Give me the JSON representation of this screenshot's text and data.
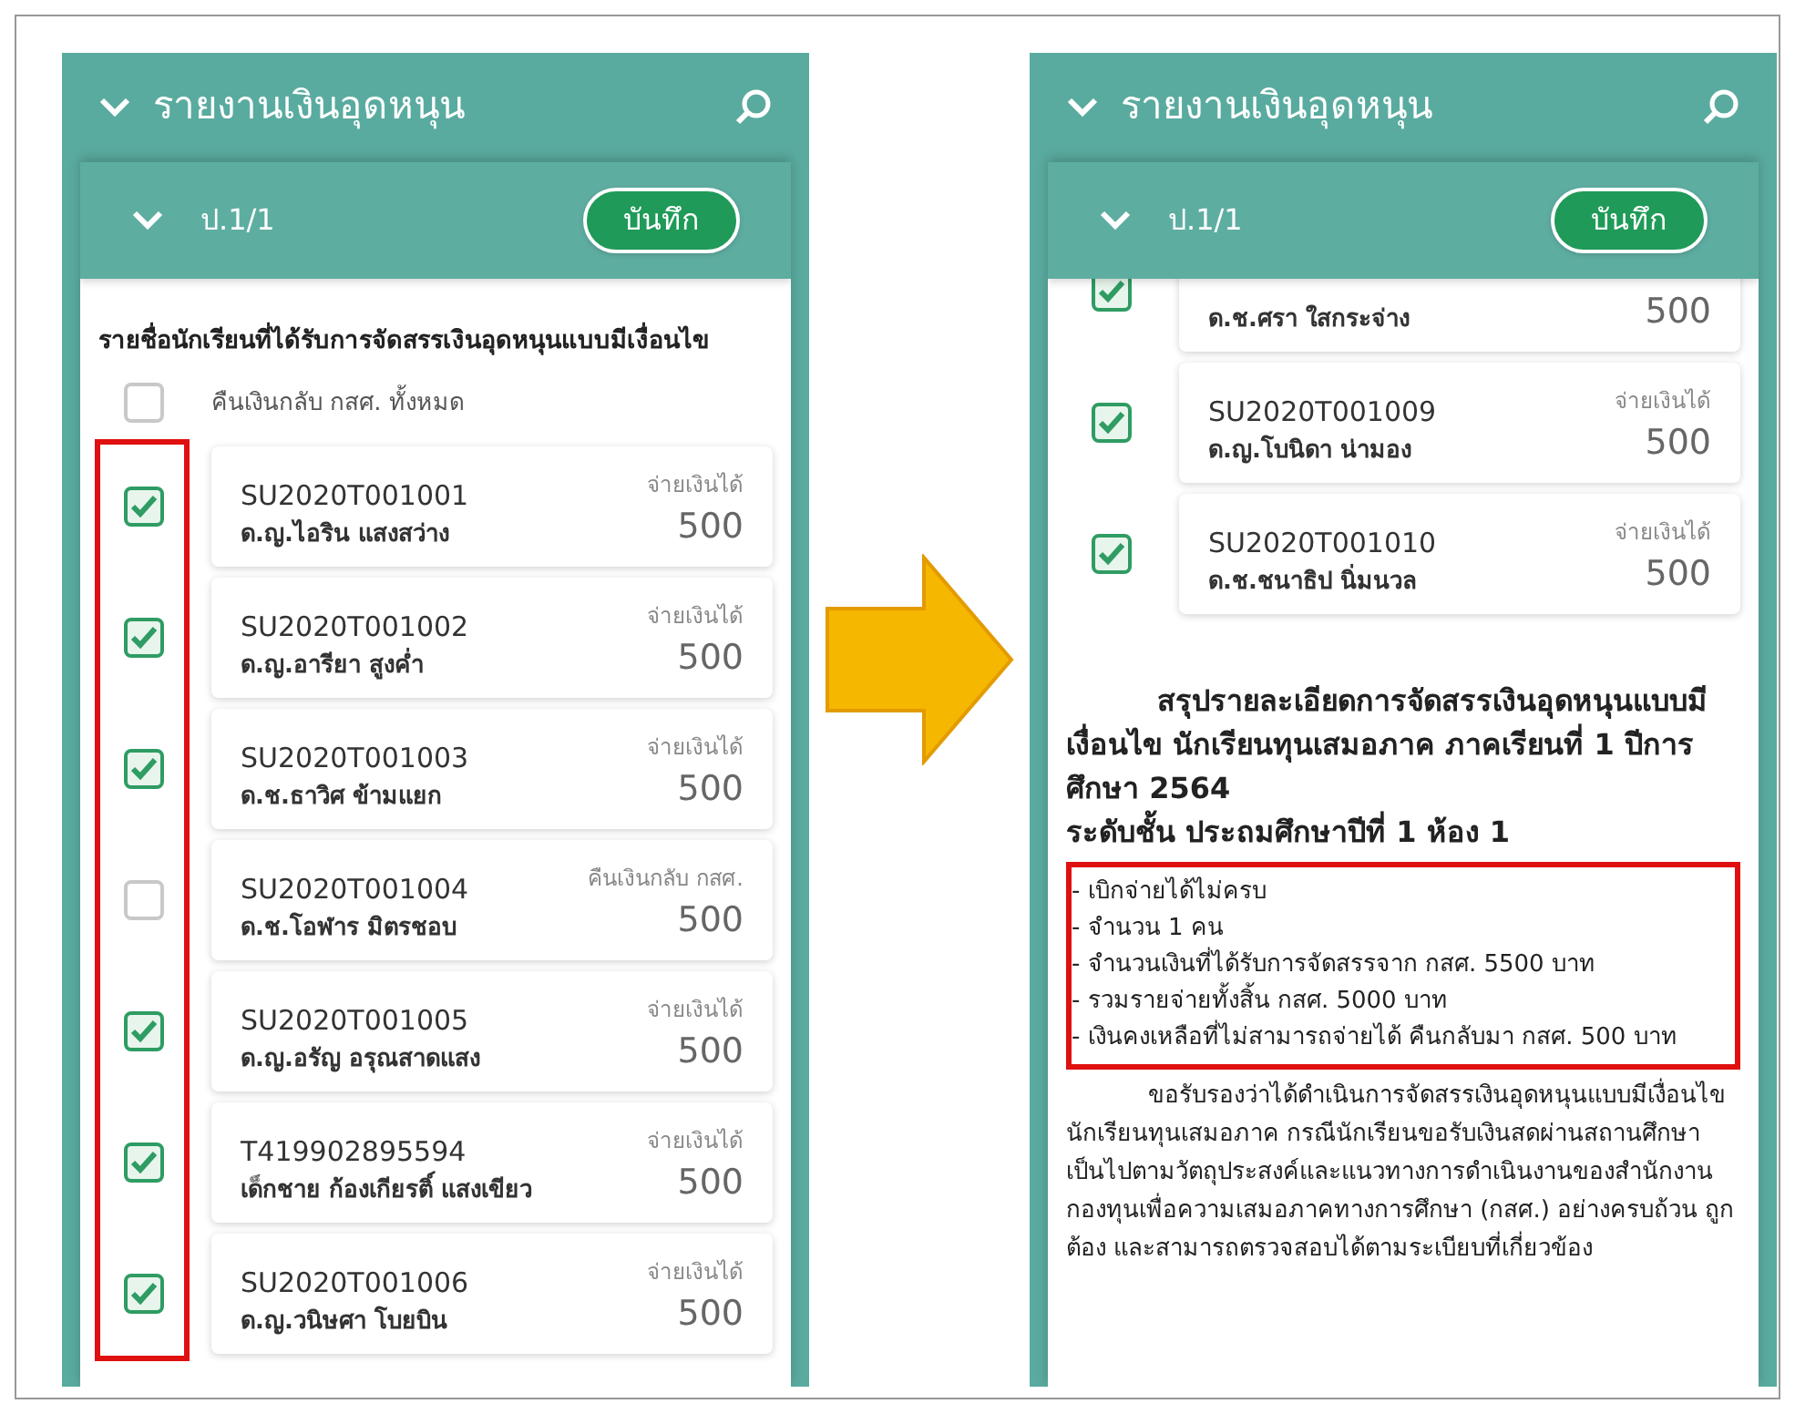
{
  "screens": [
    {
      "header_title": "รายงานเงินอุดหนุน",
      "class_label": "ป.1/1",
      "save_button": "บันทึก",
      "list_title": "รายชื่อนักเรียนที่ได้รับการจัดสรรเงินอุดหนุนแบบมีเงื่อนไข",
      "select_all": {
        "label": "คืนเงินกลับ กสศ. ทั้งหมด",
        "checked": false
      },
      "highlight_checkboxes": true,
      "students": [
        {
          "id": "SU2020T001001",
          "name": "ด.ญ.ไอริน แสงสว่าง",
          "status": "จ่ายเงินได้",
          "amount": "500",
          "checked": true
        },
        {
          "id": "SU2020T001002",
          "name": "ด.ญ.อารียา สูงค่ำ",
          "status": "จ่ายเงินได้",
          "amount": "500",
          "checked": true
        },
        {
          "id": "SU2020T001003",
          "name": "ด.ช.ธาวิศ ข้ามแยก",
          "status": "จ่ายเงินได้",
          "amount": "500",
          "checked": true
        },
        {
          "id": "SU2020T001004",
          "name": "ด.ช.โอฬาร มิตรชอบ",
          "status": "คืนเงินกลับ กสศ.",
          "amount": "500",
          "checked": false
        },
        {
          "id": "SU2020T001005",
          "name": "ด.ญ.อรัญ อรุณสาดแสง",
          "status": "จ่ายเงินได้",
          "amount": "500",
          "checked": true
        },
        {
          "id": "T419902895594",
          "name": "เด็กชาย ก้องเกียรติ์ แสงเขียว",
          "status": "จ่ายเงินได้",
          "amount": "500",
          "checked": true
        },
        {
          "id": "SU2020T001006",
          "name": "ด.ญ.วนิษศา โบยบิน",
          "status": "จ่ายเงินได้",
          "amount": "500",
          "checked": true
        }
      ]
    },
    {
      "header_title": "รายงานเงินอุดหนุน",
      "class_label": "ป.1/1",
      "save_button": "บันทึก",
      "highlight_checkboxes": false,
      "students": [
        {
          "name": "ด.ช.ศรา ใสกระจ่าง",
          "amount": "500",
          "checked": true
        },
        {
          "id": "SU2020T001009",
          "name": "ด.ญ.โบนิดา น่ามอง",
          "status": "จ่ายเงินได้",
          "amount": "500",
          "checked": true
        },
        {
          "id": "SU2020T001010",
          "name": "ด.ช.ชนาธิป นิ่มนวล",
          "status": "จ่ายเงินได้",
          "amount": "500",
          "checked": true
        }
      ],
      "summary": {
        "title": "สรุปรายละเอียดการจัดสรรเงินอุดหนุนแบบมีเงื่อนไข นักเรียนทุนเสมอภาค ภาคเรียนที่ 1 ปีการศึกษา 2564",
        "level": "ระดับชั้น ประถมศึกษาปีที่ 1 ห้อง 1",
        "highlighted": true,
        "items": [
          "- เบิกจ่ายได้ไม่ครบ",
          "- จำนวน 1 คน",
          "- จำนวนเงินที่ได้รับการจัดสรรจาก กสศ. 5500 บาท",
          "- รวมรายจ่ายทั้งสิ้น กสศ. 5000 บาท",
          "- เงินคงเหลือที่ไม่สามารถจ่ายได้ คืนกลับมา กสศ. 500 บาท"
        ],
        "certification": "ขอรับรองว่าได้ดำเนินการจัดสรรเงินอุดหนุนแบบมีเงื่อนไข นักเรียนทุนเสมอภาค กรณีนักเรียนขอรับเงินสดผ่านสถานศึกษา เป็นไปตามวัตถุประสงค์และแนวทางการดำเนินงานของสำนักงานกองทุนเพื่อความเสมอภาคทางการศึกษา (กสศ.) อย่างครบถ้วน ถูกต้อง และสามารถตรวจสอบได้ตามระเบียบที่เกี่ยวข้อง"
      }
    }
  ]
}
